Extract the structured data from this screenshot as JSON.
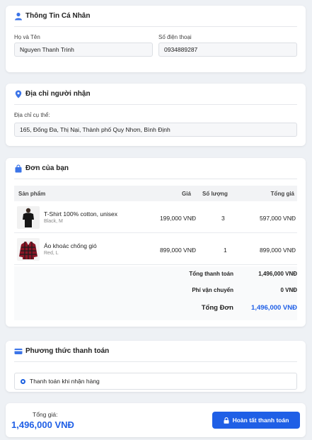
{
  "colors": {
    "accent": "#1f5fe6",
    "icon": "#3b74e8",
    "background": "#eef1f5"
  },
  "personal": {
    "title": "Thông Tin Cá Nhân",
    "icon": "user-icon",
    "name_label": "Họ và Tên",
    "name_value": "Nguyen Thanh Trinh",
    "phone_label": "Số điện thoại",
    "phone_value": "0934889287"
  },
  "address": {
    "title": "Địa chỉ người nhận",
    "icon": "map-pin-icon",
    "label": "Địa chỉ cụ thể:",
    "value": "165, Đống Đa, Thị Nại, Thành phố Quy Nhơn, Bình Định"
  },
  "order": {
    "title": "Đơn của bạn",
    "icon": "shopping-bag-icon",
    "headers": {
      "product": "Sản phẩm",
      "price": "Giá",
      "quantity": "Số lượng",
      "total": "Tổng giá"
    },
    "items": [
      {
        "name": "T-Shirt 100% cotton, unisex",
        "variant": "Black, M",
        "price": "199,000 VNĐ",
        "quantity": "3",
        "total": "597,000 VNĐ"
      },
      {
        "name": "Áo khoác chống gió",
        "variant": "Red, L",
        "price": "899,000 VNĐ",
        "quantity": "1",
        "total": "899,000 VNĐ"
      }
    ],
    "summary": {
      "subtotal_label": "Tổng thanh toán",
      "subtotal_value": "1,496,000 VNĐ",
      "shipping_label": "Phí vận chuyển",
      "shipping_value": "0 VNĐ",
      "grand_label": "Tổng Đơn",
      "grand_value": "1,496,000 VNĐ"
    }
  },
  "payment": {
    "title": "Phương thức thanh toán",
    "icon": "credit-card-icon",
    "option": "Thanh toán khi nhận hàng"
  },
  "footer": {
    "total_label": "Tổng giá:",
    "total_value": "1,496,000 VNĐ",
    "button_label": "Hoàn tất thanh toán",
    "button_icon": "lock-icon"
  }
}
